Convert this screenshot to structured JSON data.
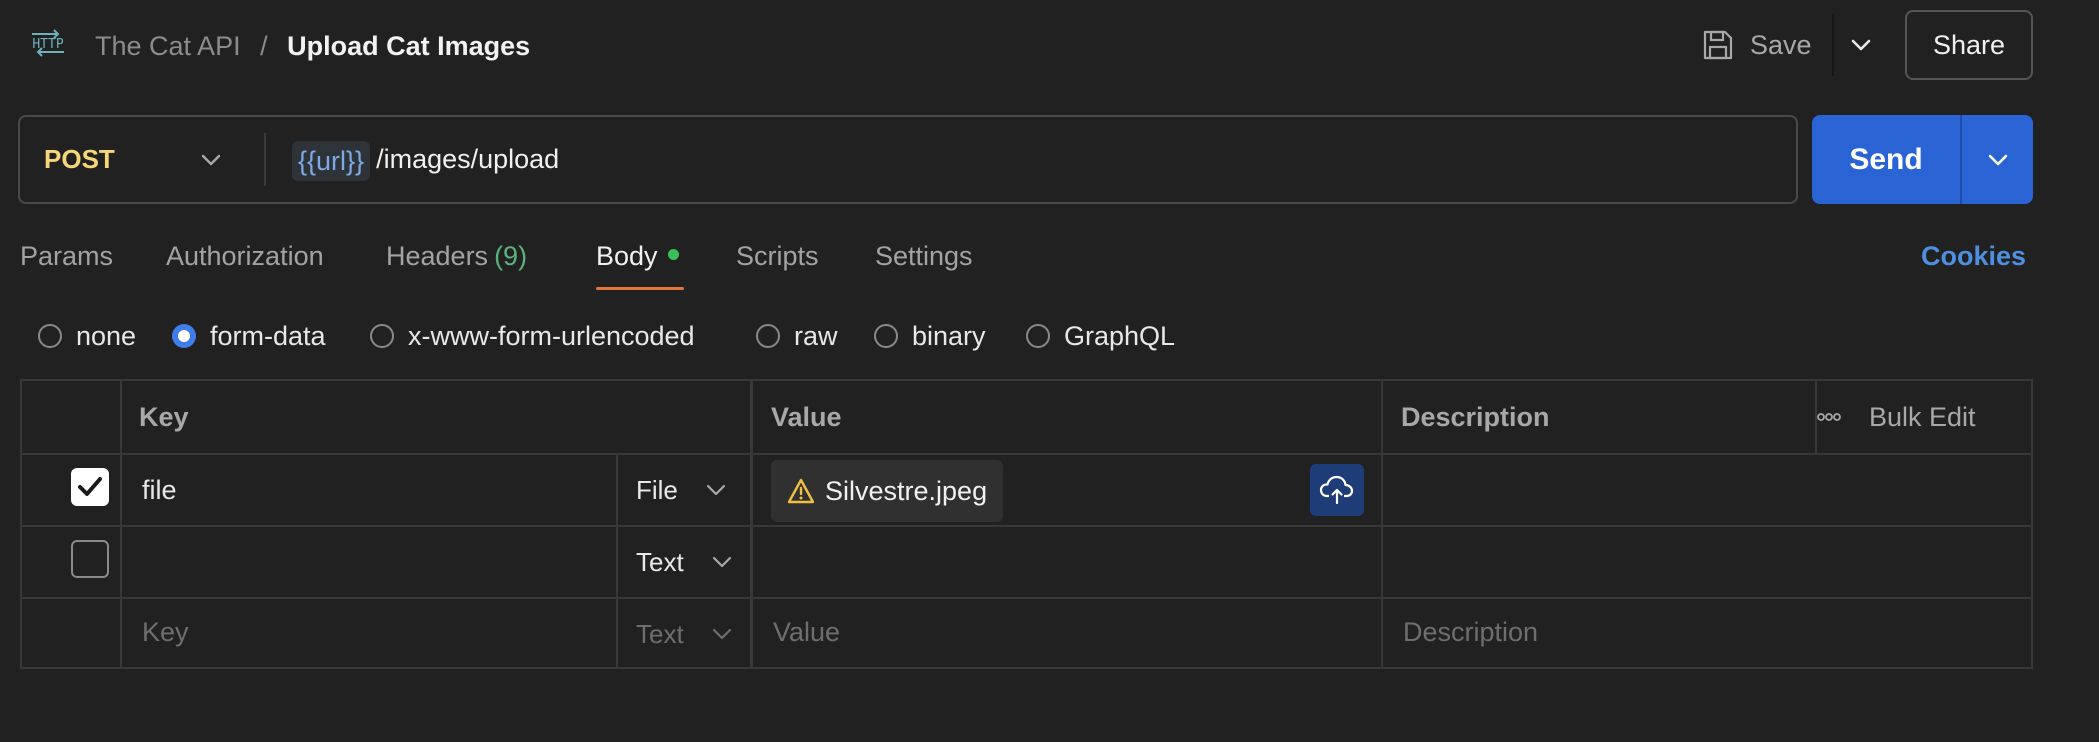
{
  "header": {
    "icon_label": "HTTP",
    "breadcrumb_parent": "The Cat API",
    "breadcrumb_separator": "/",
    "breadcrumb_current": "Upload Cat Images",
    "save_label": "Save",
    "share_label": "Share"
  },
  "request": {
    "method": "POST",
    "url_variable": "{{url}}",
    "url_path": "/images/upload",
    "send_label": "Send"
  },
  "tabs": [
    {
      "label": "Params"
    },
    {
      "label": "Authorization"
    },
    {
      "label": "Headers",
      "count": "(9)"
    },
    {
      "label": "Body"
    },
    {
      "label": "Scripts"
    },
    {
      "label": "Settings"
    }
  ],
  "cookies_label": "Cookies",
  "body_types": [
    {
      "label": "none",
      "selected": false
    },
    {
      "label": "form-data",
      "selected": true
    },
    {
      "label": "x-www-form-urlencoded",
      "selected": false
    },
    {
      "label": "raw",
      "selected": false
    },
    {
      "label": "binary",
      "selected": false
    },
    {
      "label": "GraphQL",
      "selected": false
    }
  ],
  "table": {
    "headers": {
      "key": "Key",
      "value": "Value",
      "description": "Description",
      "bulk_edit": "Bulk Edit"
    },
    "rows": [
      {
        "checked": true,
        "key": "file",
        "type": "File",
        "value": "Silvestre.jpeg",
        "description": ""
      },
      {
        "checked": false,
        "key": "",
        "type": "Text",
        "value": "",
        "description": ""
      }
    ],
    "placeholder_row": {
      "key": "Key",
      "type": "Text",
      "value": "Value",
      "description": "Description"
    }
  },
  "colors": {
    "background": "#212121",
    "method": "#f5d77a",
    "send": "#2a63d4",
    "accent_link": "#4e8fe0",
    "tab_underline": "#e2763a",
    "status_dot": "#3bbf58",
    "warning": "#f0c040"
  },
  "icons": {
    "request_type": "http-icon",
    "save": "save-icon",
    "more": "ellipsis-icon",
    "file_warning": "warning-icon",
    "upload": "cloud-upload-icon"
  }
}
